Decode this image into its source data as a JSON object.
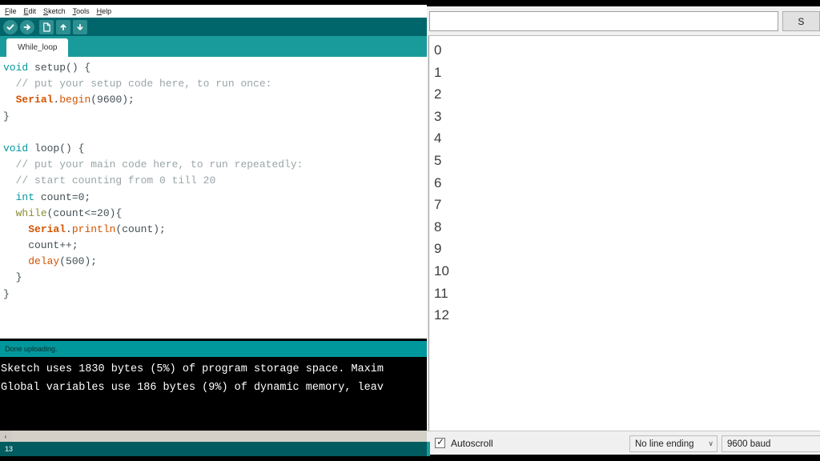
{
  "menu": {
    "items": [
      {
        "mnemonic": "F",
        "rest": "ile"
      },
      {
        "mnemonic": "E",
        "rest": "dit"
      },
      {
        "mnemonic": "S",
        "rest": "ketch"
      },
      {
        "mnemonic": "T",
        "rest": "ools"
      },
      {
        "mnemonic": "H",
        "rest": "elp"
      }
    ]
  },
  "toolbar": {
    "verify_title": "Verify",
    "upload_title": "Upload",
    "new_title": "New",
    "open_title": "Open",
    "save_title": "Save"
  },
  "tab": {
    "label": "While_loop"
  },
  "editor": {
    "lines": [
      [
        {
          "t": "void",
          "c": "kw"
        },
        {
          "t": " setup() {",
          "c": "pl"
        }
      ],
      [
        {
          "t": "  // put your setup code here, to run once:",
          "c": "cmt"
        }
      ],
      [
        {
          "t": "  ",
          "c": "pl"
        },
        {
          "t": "Serial",
          "c": "cls"
        },
        {
          "t": ".",
          "c": "pl"
        },
        {
          "t": "begin",
          "c": "fn"
        },
        {
          "t": "(9600);",
          "c": "pl"
        }
      ],
      [
        {
          "t": "}",
          "c": "pl"
        }
      ],
      [
        {
          "t": "",
          "c": "pl"
        }
      ],
      [
        {
          "t": "void",
          "c": "kw"
        },
        {
          "t": " loop() {",
          "c": "pl"
        }
      ],
      [
        {
          "t": "  // put your main code here, to run repeatedly:",
          "c": "cmt"
        }
      ],
      [
        {
          "t": "  // start counting from 0 till 20",
          "c": "cmt"
        }
      ],
      [
        {
          "t": "  ",
          "c": "pl"
        },
        {
          "t": "int",
          "c": "kw"
        },
        {
          "t": " count=0;",
          "c": "pl"
        }
      ],
      [
        {
          "t": "  ",
          "c": "pl"
        },
        {
          "t": "while",
          "c": "kw2"
        },
        {
          "t": "(count<=20){",
          "c": "pl"
        }
      ],
      [
        {
          "t": "    ",
          "c": "pl"
        },
        {
          "t": "Serial",
          "c": "cls"
        },
        {
          "t": ".",
          "c": "pl"
        },
        {
          "t": "println",
          "c": "fn"
        },
        {
          "t": "(count);",
          "c": "pl"
        }
      ],
      [
        {
          "t": "    count++;",
          "c": "pl"
        }
      ],
      [
        {
          "t": "    ",
          "c": "pl"
        },
        {
          "t": "delay",
          "c": "fn"
        },
        {
          "t": "(500);",
          "c": "pl"
        }
      ],
      [
        {
          "t": "  }",
          "c": "pl"
        }
      ],
      [
        {
          "t": "}",
          "c": "pl"
        }
      ]
    ]
  },
  "status_strip": {
    "text": "Done uploading."
  },
  "console": {
    "lines": [
      "Sketch uses 1830 bytes (5%) of program storage space. Maxim",
      "Global variables use 186 bytes (9%) of dynamic memory, leav"
    ]
  },
  "scrollbar": {
    "left_arrow": "‹"
  },
  "ide_statusbar": {
    "line_number": "13"
  },
  "serial_monitor": {
    "input_value": "",
    "input_placeholder": "",
    "send_label": "S",
    "output_lines": [
      "0",
      "1",
      "2",
      "3",
      "4",
      "5",
      "6",
      "7",
      "8",
      "9",
      "10",
      "11",
      "12"
    ],
    "autoscroll_label": "Autoscroll",
    "autoscroll_checked": "✓",
    "line_ending": "No line ending",
    "line_ending_chevron": "∨",
    "baud_rate": "9600 baud"
  },
  "colors": {
    "toolbar_bg": "#00666b",
    "tabbar_bg": "#1a9b9b",
    "status_teal": "#00979c",
    "statusbar_dark": "#005c5f",
    "keyword": "#00979c",
    "while_keyword": "#8c8c37",
    "class_name": "#d35400",
    "function_name": "#d35400",
    "comment": "#9aa5a8",
    "console_bg": "#000000"
  }
}
